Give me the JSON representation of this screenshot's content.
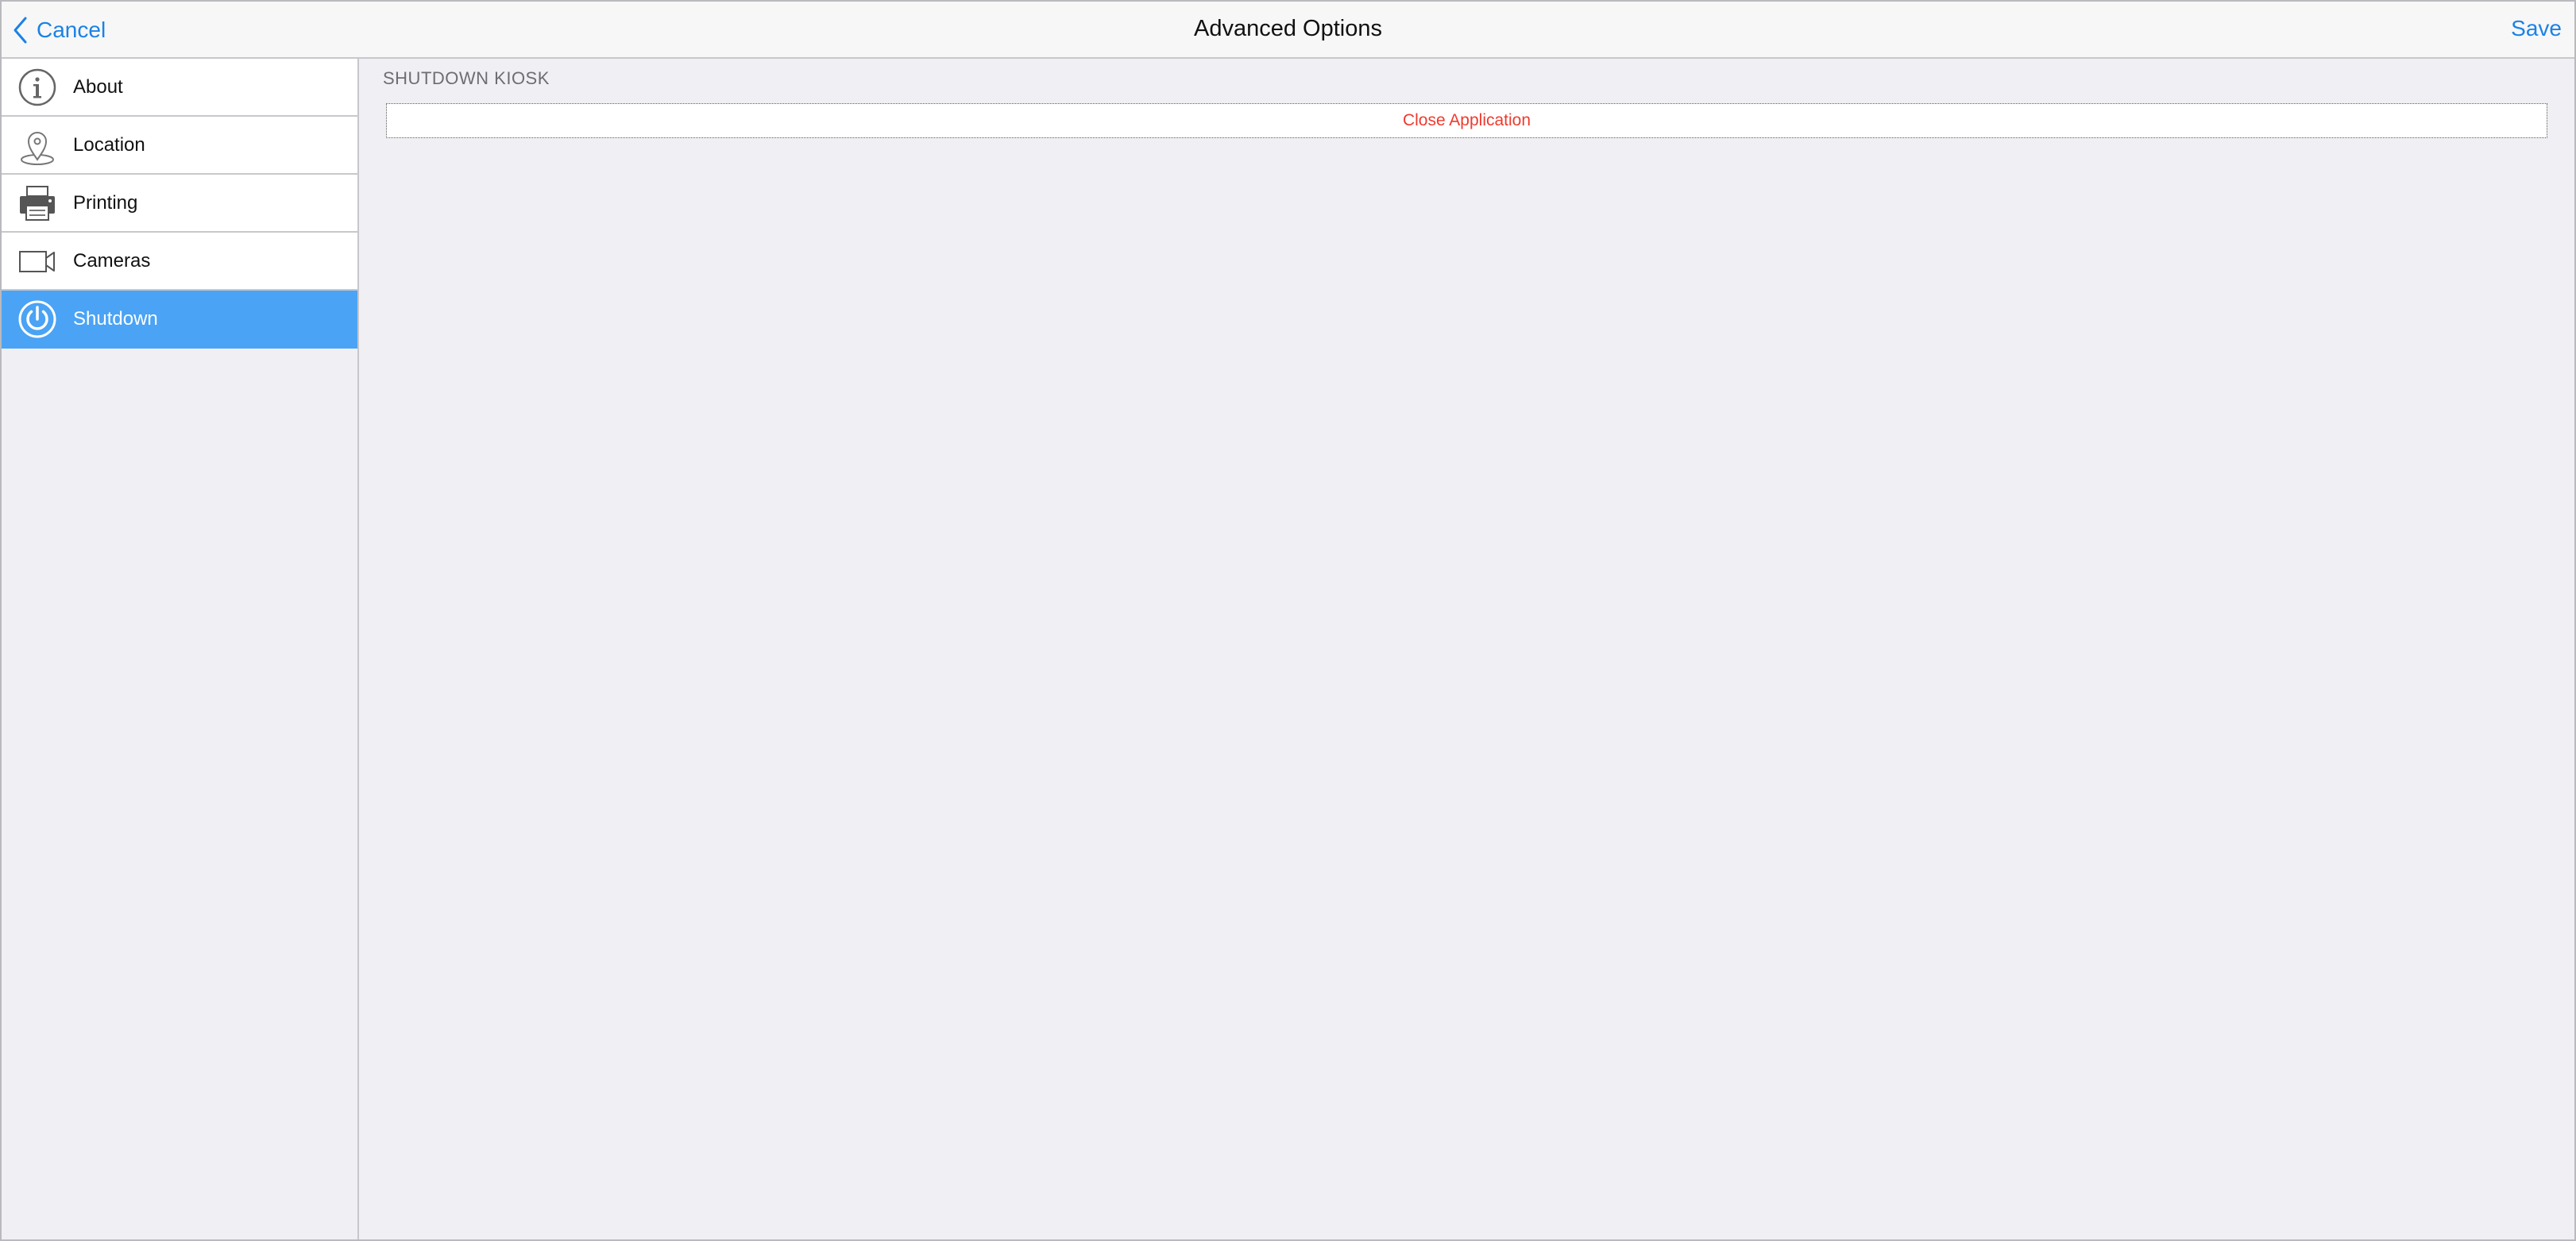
{
  "navbar": {
    "cancel_label": "Cancel",
    "title": "Advanced Options",
    "save_label": "Save"
  },
  "sidebar": {
    "items": [
      {
        "label": "About",
        "icon": "info-icon",
        "active": false
      },
      {
        "label": "Location",
        "icon": "location-pin-icon",
        "active": false
      },
      {
        "label": "Printing",
        "icon": "printer-icon",
        "active": false
      },
      {
        "label": "Cameras",
        "icon": "video-camera-icon",
        "active": false
      },
      {
        "label": "Shutdown",
        "icon": "power-icon",
        "active": true
      }
    ]
  },
  "main": {
    "section_header": "SHUTDOWN KIOSK",
    "close_button_label": "Close Application"
  },
  "colors": {
    "accent": "#1a82e6",
    "active_row": "#4aa3f4",
    "destructive": "#f03a2e",
    "background": "#efeff4"
  }
}
